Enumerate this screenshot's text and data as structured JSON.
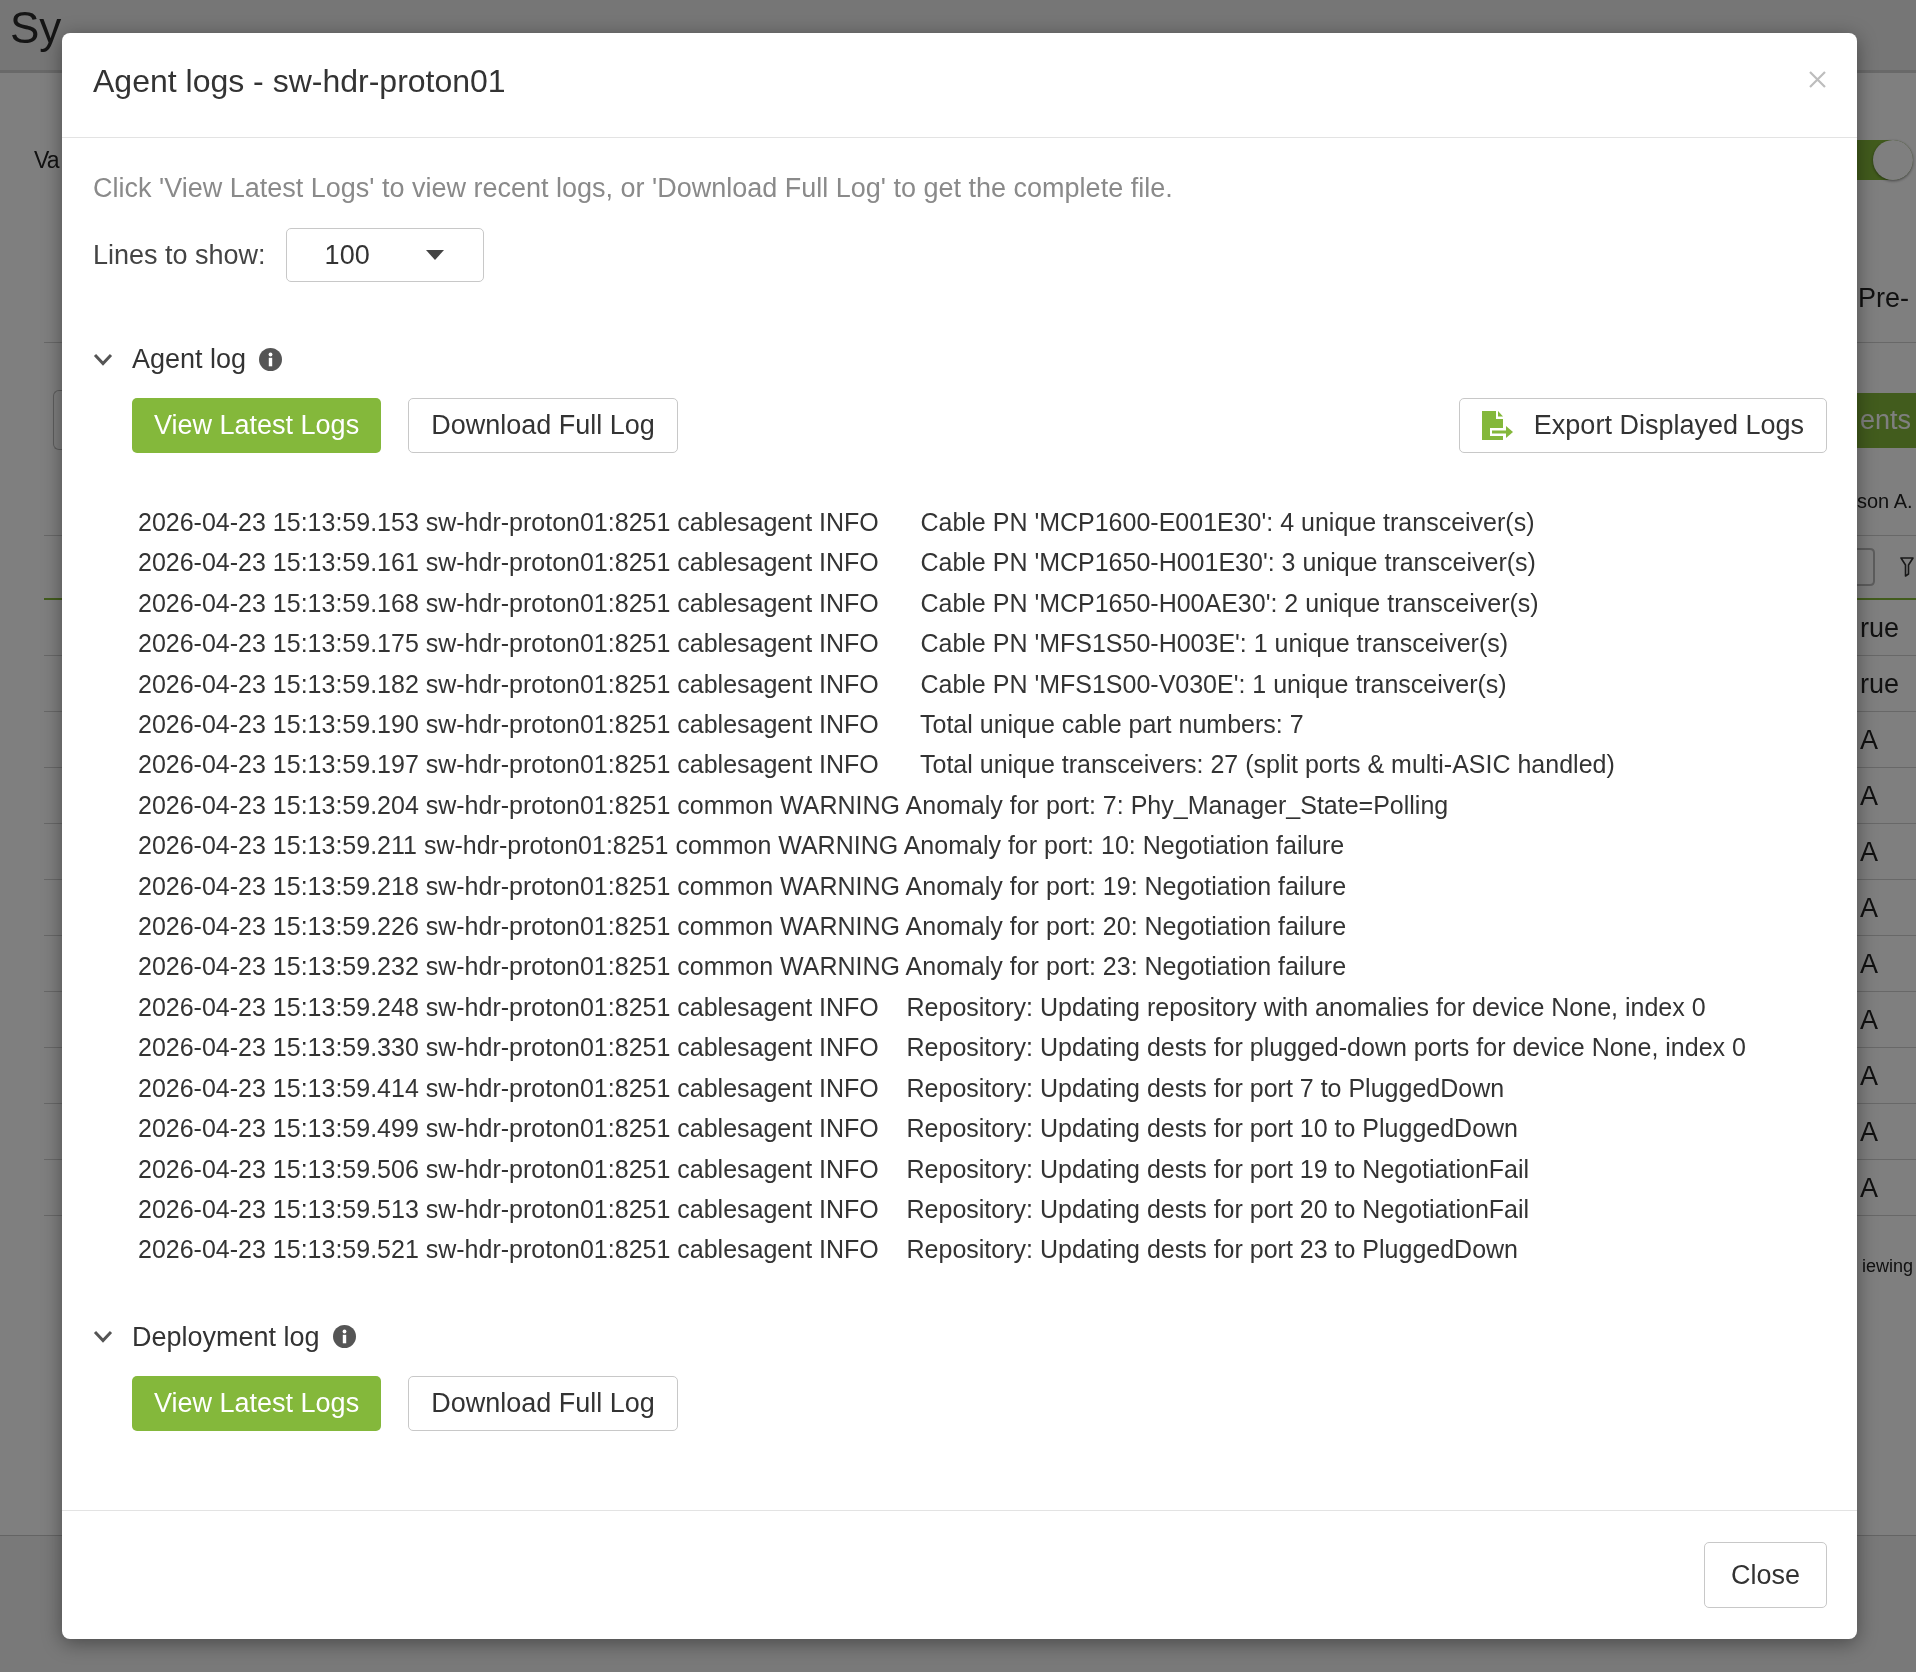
{
  "background_page": {
    "title": "Sy",
    "left_label": "Va",
    "toggle": {
      "on": true
    },
    "right_label": "Pre-",
    "action_button": "ents",
    "column_header": "son A.",
    "cells": [
      "rue",
      "rue",
      "A",
      "A",
      "A",
      "A",
      "A",
      "A",
      "A",
      "A",
      "A"
    ],
    "footer_text": "iewing"
  },
  "dialog": {
    "title": "Agent logs - sw-hdr-proton01",
    "instruction": "Click 'View Latest Logs' to view recent logs, or 'Download Full Log' to get the complete file.",
    "lines_to_show": {
      "label": "Lines to show:",
      "value": "100"
    },
    "sections": [
      {
        "title": "Agent log",
        "expanded": true,
        "buttons": [
          {
            "label": "View Latest Logs",
            "kind": "primary"
          },
          {
            "label": "Download Full Log",
            "kind": "secondary"
          },
          {
            "label": "Export Displayed Logs",
            "kind": "export"
          }
        ],
        "log_lines": [
          "2026-04-23 15:13:59.153 sw-hdr-proton01:8251 cablesagent INFO      Cable PN 'MCP1600-E001E30': 4 unique transceiver(s)",
          "2026-04-23 15:13:59.161 sw-hdr-proton01:8251 cablesagent INFO      Cable PN 'MCP1650-H001E30': 3 unique transceiver(s)",
          "2026-04-23 15:13:59.168 sw-hdr-proton01:8251 cablesagent INFO      Cable PN 'MCP1650-H00AE30': 2 unique transceiver(s)",
          "2026-04-23 15:13:59.175 sw-hdr-proton01:8251 cablesagent INFO      Cable PN 'MFS1S50-H003E': 1 unique transceiver(s)",
          "2026-04-23 15:13:59.182 sw-hdr-proton01:8251 cablesagent INFO      Cable PN 'MFS1S00-V030E': 1 unique transceiver(s)",
          "2026-04-23 15:13:59.190 sw-hdr-proton01:8251 cablesagent INFO      Total unique cable part numbers: 7",
          "2026-04-23 15:13:59.197 sw-hdr-proton01:8251 cablesagent INFO      Total unique transceivers: 27 (split ports & multi-ASIC handled)",
          "2026-04-23 15:13:59.204 sw-hdr-proton01:8251 common WARNING Anomaly for port: 7: Phy_Manager_State=Polling",
          "2026-04-23 15:13:59.211 sw-hdr-proton01:8251 common WARNING Anomaly for port: 10: Negotiation failure",
          "2026-04-23 15:13:59.218 sw-hdr-proton01:8251 common WARNING Anomaly for port: 19: Negotiation failure",
          "2026-04-23 15:13:59.226 sw-hdr-proton01:8251 common WARNING Anomaly for port: 20: Negotiation failure",
          "2026-04-23 15:13:59.232 sw-hdr-proton01:8251 common WARNING Anomaly for port: 23: Negotiation failure",
          "2026-04-23 15:13:59.248 sw-hdr-proton01:8251 cablesagent INFO    Repository: Updating repository with anomalies for device None, index 0",
          "2026-04-23 15:13:59.330 sw-hdr-proton01:8251 cablesagent INFO    Repository: Updating dests for plugged-down ports for device None, index 0",
          "2026-04-23 15:13:59.414 sw-hdr-proton01:8251 cablesagent INFO    Repository: Updating dests for port 7 to PluggedDown",
          "2026-04-23 15:13:59.499 sw-hdr-proton01:8251 cablesagent INFO    Repository: Updating dests for port 10 to PluggedDown",
          "2026-04-23 15:13:59.506 sw-hdr-proton01:8251 cablesagent INFO    Repository: Updating dests for port 19 to NegotiationFail",
          "2026-04-23 15:13:59.513 sw-hdr-proton01:8251 cablesagent INFO    Repository: Updating dests for port 20 to NegotiationFail",
          "2026-04-23 15:13:59.521 sw-hdr-proton01:8251 cablesagent INFO    Repository: Updating dests for port 23 to PluggedDown"
        ]
      },
      {
        "title": "Deployment log",
        "expanded": true,
        "buttons": [
          {
            "label": "View Latest Logs",
            "kind": "primary"
          },
          {
            "label": "Download Full Log",
            "kind": "secondary"
          }
        ]
      }
    ],
    "footer_button": "Close"
  }
}
